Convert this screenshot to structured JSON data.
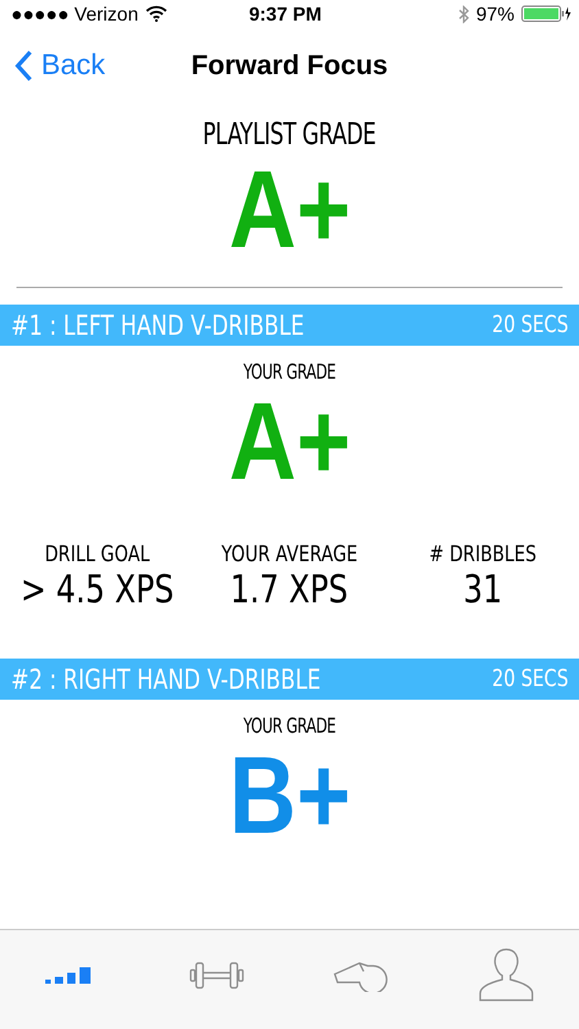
{
  "status_bar": {
    "carrier": "●●●●● Verizon",
    "time": "9:37 PM",
    "battery": "97%"
  },
  "nav": {
    "back": "Back",
    "title": "Forward Focus"
  },
  "playlist": {
    "label": "PLAYLIST GRADE",
    "grade": "A+",
    "color": "#11b011"
  },
  "drills": [
    {
      "title": "#1 : LEFT HAND V-DRIBBLE",
      "duration": "20 SECS",
      "grade_label": "YOUR GRADE",
      "grade": "A+",
      "color": "#11b011",
      "stats": [
        {
          "label": "DRILL GOAL",
          "value": "> 4.5 XPS"
        },
        {
          "label": "YOUR AVERAGE",
          "value": "1.7 XPS"
        },
        {
          "label": "# DRIBBLES",
          "value": "31"
        }
      ]
    },
    {
      "title": "#2 : RIGHT HAND V-DRIBBLE",
      "duration": "20 SECS",
      "grade_label": "YOUR GRADE",
      "grade": "B+",
      "color": "#118ee8"
    }
  ],
  "tabs": [
    {
      "kind": "stats",
      "selected": true
    },
    {
      "kind": "workout",
      "selected": false
    },
    {
      "kind": "whistle",
      "selected": false
    },
    {
      "kind": "profile",
      "selected": false
    }
  ]
}
